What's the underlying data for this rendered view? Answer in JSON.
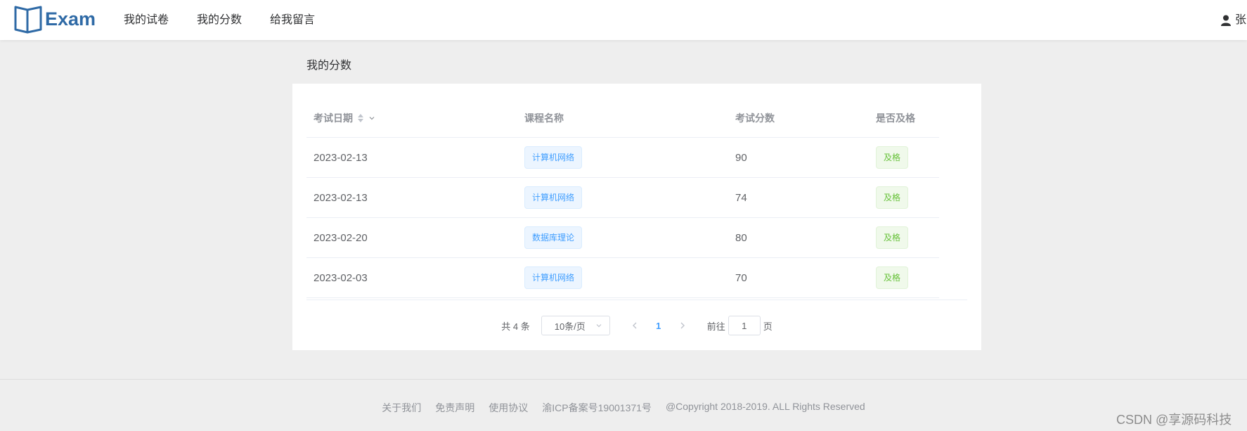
{
  "header": {
    "logo_text": "Exam",
    "nav": [
      "我的试卷",
      "我的分数",
      "给我留言"
    ],
    "user_name": "张"
  },
  "page": {
    "title": "我的分数"
  },
  "table": {
    "columns": [
      "考试日期",
      "课程名称",
      "考试分数",
      "是否及格"
    ],
    "rows": [
      {
        "date": "2023-02-13",
        "course": "计算机网络",
        "score": "90",
        "status": "及格"
      },
      {
        "date": "2023-02-13",
        "course": "计算机网络",
        "score": "74",
        "status": "及格"
      },
      {
        "date": "2023-02-20",
        "course": "数据库理论",
        "score": "80",
        "status": "及格"
      },
      {
        "date": "2023-02-03",
        "course": "计算机网络",
        "score": "70",
        "status": "及格"
      }
    ]
  },
  "pagination": {
    "total_text": "共 4 条",
    "page_size": "10条/页",
    "current_page": "1",
    "goto_prefix": "前往",
    "goto_value": "1",
    "goto_suffix": "页"
  },
  "footer": {
    "links": [
      "关于我们",
      "免责声明",
      "使用协议",
      "渝ICP备案号19001371号"
    ],
    "copyright": "@Copyright 2018-2019. ALL Rights Reserved"
  },
  "watermark": "CSDN @享源码科技",
  "colors": {
    "accent": "#409eff",
    "success": "#67c23a",
    "brand": "#2f6aa6"
  }
}
